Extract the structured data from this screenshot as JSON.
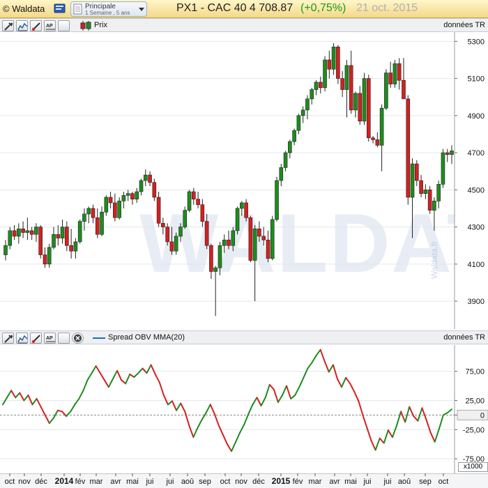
{
  "app": {
    "brand": "© Waldata",
    "workspace_title": "Principale",
    "workspace_sub": "1 Semaine , 5 ans"
  },
  "instrument": {
    "title": "PX1 - CAC 40  4 708.87",
    "change": "(+0,75%)",
    "date": "21 oct. 2015"
  },
  "price_panel": {
    "legend": "Prix",
    "source": "données TR"
  },
  "osc_panel": {
    "legend": "Spread OBV MMA(20)",
    "source": "données TR",
    "multiplier": "x1000"
  },
  "price_axis": {
    "ticks": [
      "5300",
      "5100",
      "4900",
      "4700",
      "4500",
      "4300",
      "4100",
      "3900"
    ]
  },
  "osc_axis": {
    "ticks": [
      "75,00",
      "25,00",
      "0",
      "-25,00",
      "-75,00"
    ]
  },
  "time_axis": {
    "labels": [
      "oct",
      "nov",
      "déc",
      "2014",
      "fév",
      "mar",
      "avr",
      "mai",
      "jui",
      "jui",
      "aoû",
      "sep",
      "oct",
      "nov",
      "déc",
      "2015",
      "fév",
      "mar",
      "avr",
      "mai",
      "jui",
      "jui",
      "aoû",
      "sep",
      "oct"
    ]
  },
  "watermark": {
    "text": "WALDATA",
    "vertical": "Waldata.fr"
  },
  "colors": {
    "up": "#1e8c1e",
    "down": "#d42020",
    "title_bg": "#f3d98a",
    "osc_line": "#1a6ad4"
  },
  "chart_data": [
    {
      "type": "candlestick",
      "title": "PX1 - CAC 40",
      "ylim": [
        3750,
        5350
      ],
      "series": [
        {
          "name": "Prix",
          "ohlc": [
            [
              4150,
              4230,
              4120,
              4200
            ],
            [
              4200,
              4300,
              4180,
              4280
            ],
            [
              4280,
              4310,
              4230,
              4250
            ],
            [
              4250,
              4320,
              4210,
              4290
            ],
            [
              4290,
              4330,
              4240,
              4270
            ],
            [
              4270,
              4350,
              4230,
              4280
            ],
            [
              4280,
              4300,
              4230,
              4260
            ],
            [
              4260,
              4320,
              4220,
              4300
            ],
            [
              4300,
              4310,
              4130,
              4150
            ],
            [
              4150,
              4190,
              4080,
              4100
            ],
            [
              4100,
              4210,
              4080,
              4190
            ],
            [
              4190,
              4300,
              4180,
              4260
            ],
            [
              4260,
              4310,
              4200,
              4240
            ],
            [
              4240,
              4340,
              4210,
              4300
            ],
            [
              4300,
              4330,
              4170,
              4200
            ],
            [
              4200,
              4290,
              4130,
              4170
            ],
            [
              4170,
              4240,
              4130,
              4220
            ],
            [
              4220,
              4340,
              4210,
              4330
            ],
            [
              4330,
              4400,
              4280,
              4370
            ],
            [
              4370,
              4410,
              4320,
              4400
            ],
            [
              4400,
              4420,
              4320,
              4350
            ],
            [
              4350,
              4400,
              4240,
              4260
            ],
            [
              4260,
              4410,
              4250,
              4380
            ],
            [
              4380,
              4470,
              4360,
              4460
            ],
            [
              4460,
              4490,
              4400,
              4430
            ],
            [
              4430,
              4480,
              4330,
              4350
            ],
            [
              4350,
              4460,
              4340,
              4440
            ],
            [
              4440,
              4490,
              4400,
              4470
            ],
            [
              4470,
              4500,
              4440,
              4480
            ],
            [
              4480,
              4490,
              4420,
              4450
            ],
            [
              4450,
              4510,
              4430,
              4490
            ],
            [
              4490,
              4560,
              4470,
              4550
            ],
            [
              4550,
              4610,
              4520,
              4580
            ],
            [
              4580,
              4600,
              4520,
              4540
            ],
            [
              4540,
              4560,
              4440,
              4460
            ],
            [
              4460,
              4490,
              4300,
              4320
            ],
            [
              4320,
              4350,
              4260,
              4300
            ],
            [
              4300,
              4320,
              4200,
              4220
            ],
            [
              4220,
              4300,
              4150,
              4170
            ],
            [
              4170,
              4270,
              4150,
              4250
            ],
            [
              4250,
              4320,
              4220,
              4300
            ],
            [
              4300,
              4410,
              4290,
              4390
            ],
            [
              4390,
              4500,
              4380,
              4490
            ],
            [
              4490,
              4510,
              4420,
              4450
            ],
            [
              4450,
              4490,
              4400,
              4420
            ],
            [
              4420,
              4450,
              4300,
              4330
            ],
            [
              4330,
              4370,
              4180,
              4200
            ],
            [
              4200,
              4210,
              4020,
              4060
            ],
            [
              4060,
              4090,
              3820,
              4080
            ],
            [
              4080,
              4220,
              4040,
              4200
            ],
            [
              4200,
              4260,
              4160,
              4230
            ],
            [
              4230,
              4280,
              4180,
              4200
            ],
            [
              4200,
              4300,
              4170,
              4280
            ],
            [
              4280,
              4410,
              4260,
              4400
            ],
            [
              4400,
              4440,
              4360,
              4430
            ],
            [
              4430,
              4450,
              4330,
              4350
            ],
            [
              4350,
              4360,
              4110,
              4120
            ],
            [
              4120,
              4310,
              3900,
              4290
            ],
            [
              4290,
              4330,
              4220,
              4250
            ],
            [
              4250,
              4300,
              4200,
              4230
            ],
            [
              4230,
              4280,
              4110,
              4130
            ],
            [
              4130,
              4360,
              4120,
              4340
            ],
            [
              4340,
              4570,
              4330,
              4550
            ],
            [
              4550,
              4640,
              4520,
              4620
            ],
            [
              4620,
              4710,
              4600,
              4700
            ],
            [
              4700,
              4770,
              4670,
              4760
            ],
            [
              4760,
              4830,
              4740,
              4820
            ],
            [
              4820,
              4910,
              4800,
              4900
            ],
            [
              4900,
              4950,
              4860,
              4930
            ],
            [
              4930,
              5010,
              4880,
              4990
            ],
            [
              4990,
              5050,
              4960,
              5040
            ],
            [
              5040,
              5090,
              5010,
              5080
            ],
            [
              5080,
              5110,
              5020,
              5050
            ],
            [
              5050,
              5220,
              5030,
              5200
            ],
            [
              5200,
              5250,
              5100,
              5150
            ],
            [
              5150,
              5290,
              5120,
              5270
            ],
            [
              5270,
              5280,
              5070,
              5100
            ],
            [
              5100,
              5140,
              5000,
              5040
            ],
            [
              5040,
              5200,
              4890,
              5170
            ],
            [
              5170,
              5250,
              4910,
              4930
            ],
            [
              4930,
              5030,
              4890,
              5020
            ],
            [
              5020,
              5060,
              4850,
              4870
            ],
            [
              4870,
              5130,
              4850,
              5100
            ],
            [
              5100,
              5120,
              4760,
              4780
            ],
            [
              4780,
              4790,
              4750,
              4770
            ],
            [
              4770,
              4810,
              4730,
              4740
            ],
            [
              4740,
              4960,
              4600,
              4940
            ],
            [
              4940,
              5150,
              4930,
              5130
            ],
            [
              5130,
              5190,
              5050,
              5070
            ],
            [
              5070,
              5200,
              5050,
              5180
            ],
            [
              5180,
              5210,
              5040,
              5090
            ],
            [
              5090,
              5210,
              5030,
              4990
            ],
            [
              4990,
              5010,
              4420,
              4460
            ],
            [
              4460,
              4670,
              4240,
              4640
            ],
            [
              4640,
              4660,
              4520,
              4550
            ],
            [
              4550,
              4580,
              4460,
              4480
            ],
            [
              4480,
              4530,
              4450,
              4500
            ],
            [
              4500,
              4520,
              4370,
              4390
            ],
            [
              4390,
              4460,
              4280,
              4440
            ],
            [
              4440,
              4550,
              4400,
              4530
            ],
            [
              4530,
              4720,
              4510,
              4700
            ],
            [
              4700,
              4720,
              4650,
              4690
            ],
            [
              4690,
              4740,
              4640,
              4710
            ]
          ]
        }
      ]
    },
    {
      "type": "line",
      "title": "Spread OBV MMA(20)",
      "ylim": [
        -100,
        120
      ],
      "series": [
        {
          "name": "Spread OBV MMA(20)",
          "values": [
            18,
            30,
            42,
            30,
            38,
            25,
            34,
            18,
            28,
            14,
            0,
            -14,
            -5,
            8,
            6,
            -2,
            6,
            18,
            28,
            42,
            60,
            72,
            84,
            72,
            60,
            48,
            62,
            76,
            60,
            54,
            70,
            65,
            72,
            80,
            72,
            86,
            70,
            56,
            34,
            18,
            24,
            8,
            20,
            6,
            -18,
            -38,
            -22,
            -8,
            4,
            18,
            2,
            -18,
            -34,
            -50,
            -62,
            -46,
            -30,
            -16,
            2,
            18,
            30,
            16,
            30,
            52,
            44,
            22,
            34,
            50,
            28,
            34,
            48,
            64,
            80,
            90,
            102,
            112,
            92,
            74,
            86,
            62,
            48,
            64,
            54,
            40,
            24,
            0,
            -22,
            -44,
            -60,
            -40,
            -48,
            -26,
            -38,
            -18,
            6,
            -12,
            14,
            -2,
            -10,
            12,
            -8,
            -30,
            -46,
            -24,
            0,
            4,
            10
          ]
        }
      ]
    }
  ]
}
